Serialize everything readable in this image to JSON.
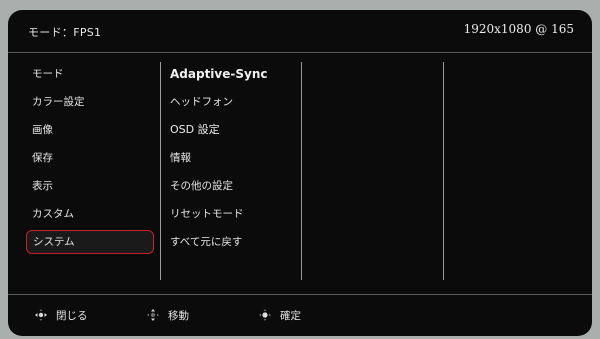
{
  "header": {
    "mode_label": "モード：FPS1",
    "resolution": "1920x1080 @ 165"
  },
  "menu": {
    "items": [
      {
        "label": "モード"
      },
      {
        "label": "カラー設定"
      },
      {
        "label": "画像"
      },
      {
        "label": "保存"
      },
      {
        "label": "表示"
      },
      {
        "label": "カスタム"
      },
      {
        "label": "システム",
        "selected": true
      }
    ]
  },
  "submenu": {
    "items": [
      {
        "label": "Adaptive-Sync"
      },
      {
        "label": "ヘッドフォン"
      },
      {
        "label": "OSD 設定"
      },
      {
        "label": "情報"
      },
      {
        "label": "その他の設定"
      },
      {
        "label": "リセットモード"
      },
      {
        "label": "すべて元に戻す"
      }
    ]
  },
  "footer": {
    "close_label": "閉じる",
    "move_label": "移動",
    "confirm_label": "確定",
    "close_icon": "dpad-left-right-icon",
    "move_icon": "dpad-up-down-icon",
    "confirm_icon": "dpad-center-icon"
  },
  "colors": {
    "background": "#0b0b0b",
    "selection_border": "#c81e28",
    "text": "#e4e4e4"
  }
}
